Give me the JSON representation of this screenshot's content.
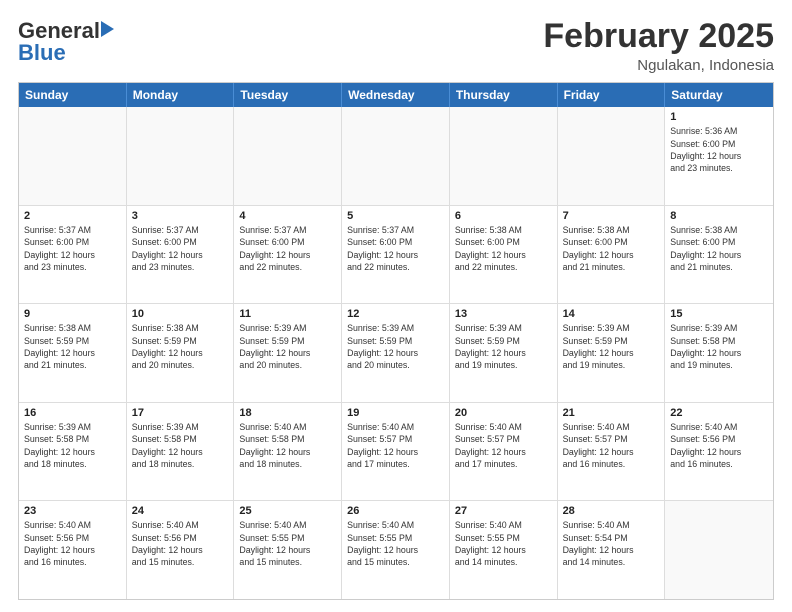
{
  "header": {
    "logo_general": "General",
    "logo_blue": "Blue",
    "month_title": "February 2025",
    "location": "Ngulakan, Indonesia"
  },
  "calendar": {
    "days_of_week": [
      "Sunday",
      "Monday",
      "Tuesday",
      "Wednesday",
      "Thursday",
      "Friday",
      "Saturday"
    ],
    "weeks": [
      [
        {
          "day": "",
          "info": ""
        },
        {
          "day": "",
          "info": ""
        },
        {
          "day": "",
          "info": ""
        },
        {
          "day": "",
          "info": ""
        },
        {
          "day": "",
          "info": ""
        },
        {
          "day": "",
          "info": ""
        },
        {
          "day": "1",
          "info": "Sunrise: 5:36 AM\nSunset: 6:00 PM\nDaylight: 12 hours\nand 23 minutes."
        }
      ],
      [
        {
          "day": "2",
          "info": "Sunrise: 5:37 AM\nSunset: 6:00 PM\nDaylight: 12 hours\nand 23 minutes."
        },
        {
          "day": "3",
          "info": "Sunrise: 5:37 AM\nSunset: 6:00 PM\nDaylight: 12 hours\nand 23 minutes."
        },
        {
          "day": "4",
          "info": "Sunrise: 5:37 AM\nSunset: 6:00 PM\nDaylight: 12 hours\nand 22 minutes."
        },
        {
          "day": "5",
          "info": "Sunrise: 5:37 AM\nSunset: 6:00 PM\nDaylight: 12 hours\nand 22 minutes."
        },
        {
          "day": "6",
          "info": "Sunrise: 5:38 AM\nSunset: 6:00 PM\nDaylight: 12 hours\nand 22 minutes."
        },
        {
          "day": "7",
          "info": "Sunrise: 5:38 AM\nSunset: 6:00 PM\nDaylight: 12 hours\nand 21 minutes."
        },
        {
          "day": "8",
          "info": "Sunrise: 5:38 AM\nSunset: 6:00 PM\nDaylight: 12 hours\nand 21 minutes."
        }
      ],
      [
        {
          "day": "9",
          "info": "Sunrise: 5:38 AM\nSunset: 5:59 PM\nDaylight: 12 hours\nand 21 minutes."
        },
        {
          "day": "10",
          "info": "Sunrise: 5:38 AM\nSunset: 5:59 PM\nDaylight: 12 hours\nand 20 minutes."
        },
        {
          "day": "11",
          "info": "Sunrise: 5:39 AM\nSunset: 5:59 PM\nDaylight: 12 hours\nand 20 minutes."
        },
        {
          "day": "12",
          "info": "Sunrise: 5:39 AM\nSunset: 5:59 PM\nDaylight: 12 hours\nand 20 minutes."
        },
        {
          "day": "13",
          "info": "Sunrise: 5:39 AM\nSunset: 5:59 PM\nDaylight: 12 hours\nand 19 minutes."
        },
        {
          "day": "14",
          "info": "Sunrise: 5:39 AM\nSunset: 5:59 PM\nDaylight: 12 hours\nand 19 minutes."
        },
        {
          "day": "15",
          "info": "Sunrise: 5:39 AM\nSunset: 5:58 PM\nDaylight: 12 hours\nand 19 minutes."
        }
      ],
      [
        {
          "day": "16",
          "info": "Sunrise: 5:39 AM\nSunset: 5:58 PM\nDaylight: 12 hours\nand 18 minutes."
        },
        {
          "day": "17",
          "info": "Sunrise: 5:39 AM\nSunset: 5:58 PM\nDaylight: 12 hours\nand 18 minutes."
        },
        {
          "day": "18",
          "info": "Sunrise: 5:40 AM\nSunset: 5:58 PM\nDaylight: 12 hours\nand 18 minutes."
        },
        {
          "day": "19",
          "info": "Sunrise: 5:40 AM\nSunset: 5:57 PM\nDaylight: 12 hours\nand 17 minutes."
        },
        {
          "day": "20",
          "info": "Sunrise: 5:40 AM\nSunset: 5:57 PM\nDaylight: 12 hours\nand 17 minutes."
        },
        {
          "day": "21",
          "info": "Sunrise: 5:40 AM\nSunset: 5:57 PM\nDaylight: 12 hours\nand 16 minutes."
        },
        {
          "day": "22",
          "info": "Sunrise: 5:40 AM\nSunset: 5:56 PM\nDaylight: 12 hours\nand 16 minutes."
        }
      ],
      [
        {
          "day": "23",
          "info": "Sunrise: 5:40 AM\nSunset: 5:56 PM\nDaylight: 12 hours\nand 16 minutes."
        },
        {
          "day": "24",
          "info": "Sunrise: 5:40 AM\nSunset: 5:56 PM\nDaylight: 12 hours\nand 15 minutes."
        },
        {
          "day": "25",
          "info": "Sunrise: 5:40 AM\nSunset: 5:55 PM\nDaylight: 12 hours\nand 15 minutes."
        },
        {
          "day": "26",
          "info": "Sunrise: 5:40 AM\nSunset: 5:55 PM\nDaylight: 12 hours\nand 15 minutes."
        },
        {
          "day": "27",
          "info": "Sunrise: 5:40 AM\nSunset: 5:55 PM\nDaylight: 12 hours\nand 14 minutes."
        },
        {
          "day": "28",
          "info": "Sunrise: 5:40 AM\nSunset: 5:54 PM\nDaylight: 12 hours\nand 14 minutes."
        },
        {
          "day": "",
          "info": ""
        }
      ]
    ]
  }
}
